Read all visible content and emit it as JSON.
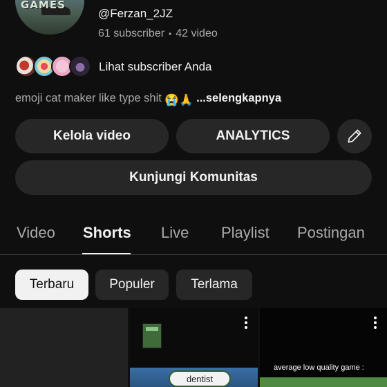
{
  "channel": {
    "avatar_text": "GAMES",
    "handle": "@Ferzan_2JZ",
    "subscribers": "61 subscriber",
    "separator": "•",
    "videos": "42 video",
    "see_subscribers": "Lihat subscriber Anda",
    "description": "emoji cat maker like type shit",
    "description_emoji": "😭🙏",
    "more_link": "...selengkapnya"
  },
  "actions": {
    "manage_videos": "Kelola video",
    "analytics": "ANALYTICS",
    "edit_icon": "pencil-icon",
    "community": "Kunjungi Komunitas"
  },
  "tabs": [
    {
      "label": "Video",
      "active": false
    },
    {
      "label": "Shorts",
      "active": true
    },
    {
      "label": "Live",
      "active": false
    },
    {
      "label": "Playlist",
      "active": false
    },
    {
      "label": "Postingan",
      "active": false
    }
  ],
  "filters": [
    {
      "label": "Terbaru",
      "active": true
    },
    {
      "label": "Populer",
      "active": false
    },
    {
      "label": "Terlama",
      "active": false
    }
  ],
  "shorts": [
    {
      "caption": ""
    },
    {
      "caption": "dentist"
    },
    {
      "caption": "average low quality game :"
    }
  ],
  "colors": {
    "background": "#0f0f0f",
    "button": "#272727",
    "text": "#f1f1f1",
    "secondary_text": "#aaaaaa"
  }
}
